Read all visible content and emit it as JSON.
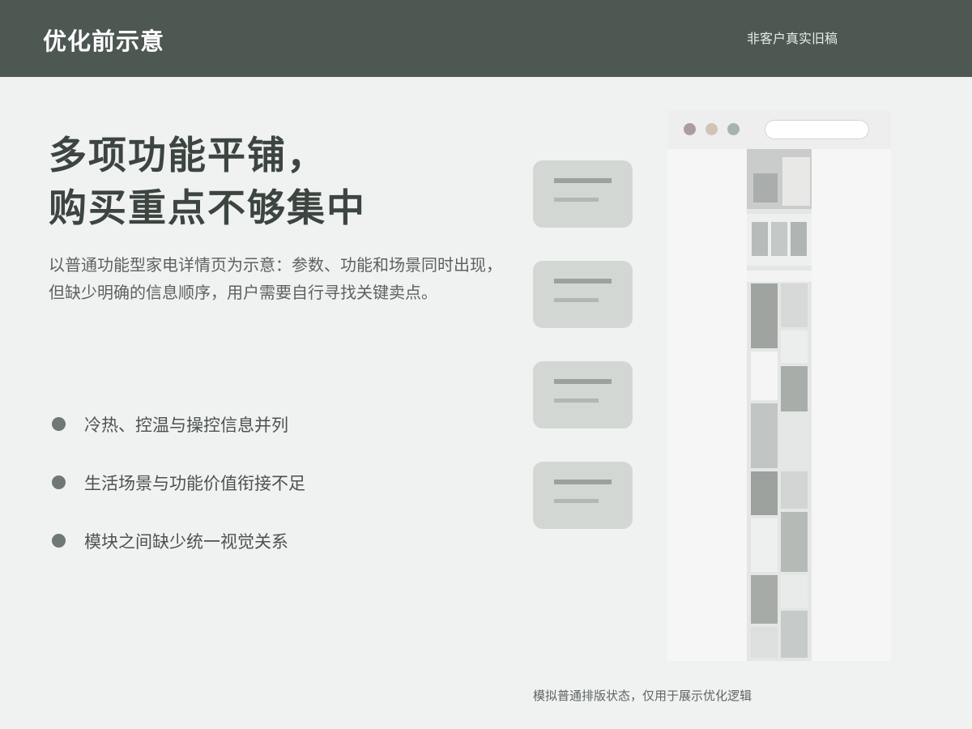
{
  "header": {
    "title": "优化前示意",
    "note": "非客户真实旧稿"
  },
  "headline": {
    "line1": "多项功能平铺，",
    "line2": "购买重点不够集中"
  },
  "description": "以普通功能型家电详情页为示意：参数、功能和场景同时出现，但缺少明确的信息顺序，用户需要自行寻找关键卖点。",
  "bullets": [
    "冷热、控温与操控信息并列",
    "生活场景与功能价值衔接不足",
    "模块之间缺少统一视觉关系"
  ],
  "caption": "模拟普通排版状态，仅用于展示优化逻辑",
  "colors": {
    "header_bg": "#4e5853",
    "page_bg": "#f0f2f1",
    "card_bg": "#d3d7d4",
    "bullet_dot": "#6f7873",
    "window_dots": [
      "#ae9c9d",
      "#d1c4b6",
      "#a5b5ab"
    ]
  }
}
